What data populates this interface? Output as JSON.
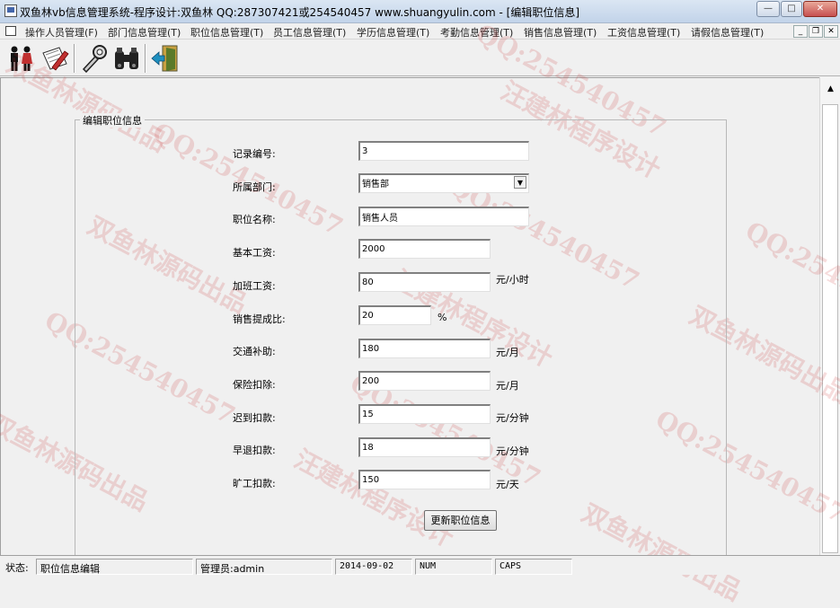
{
  "window": {
    "title": "双鱼林vb信息管理系统-程序设计:双鱼林 QQ:287307421或254540457 www.shuangyulin.com - [编辑职位信息]",
    "controls": {
      "minimize": "—",
      "maximize": "□",
      "close": "✕"
    }
  },
  "menu": {
    "items": [
      "操作人员管理(F)",
      "部门信息管理(T)",
      "职位信息管理(T)",
      "员工信息管理(T)",
      "学历信息管理(T)",
      "考勤信息管理(T)",
      "销售信息管理(T)",
      "工资信息管理(T)",
      "请假信息管理(T)"
    ],
    "mdi_controls": {
      "minimize": "_",
      "restore": "❐",
      "close": "✕"
    }
  },
  "toolbar": {
    "icons": [
      "people-icon",
      "edit-icon",
      "wrench-icon",
      "binoculars-icon",
      "exit-door-icon"
    ]
  },
  "form": {
    "group_title": "编辑职位信息",
    "fields": {
      "record_no": {
        "label": "记录编号:",
        "value": "3"
      },
      "department": {
        "label": "所属部门:",
        "value": "销售部"
      },
      "position_name": {
        "label": "职位名称:",
        "value": "销售人员"
      },
      "base_salary": {
        "label": "基本工资:",
        "value": "2000"
      },
      "overtime_pay": {
        "label": "加班工资:",
        "value": "80",
        "unit": "元/小时"
      },
      "commission_rate": {
        "label": "销售提成比:",
        "value": "20",
        "unit": "%"
      },
      "transport_allowance": {
        "label": "交通补助:",
        "value": "180",
        "unit": "元/月"
      },
      "insurance_deduction": {
        "label": "保险扣除:",
        "value": "200",
        "unit": "元/月"
      },
      "late_deduction": {
        "label": "迟到扣款:",
        "value": "15",
        "unit": "元/分钟"
      },
      "early_leave_deduction": {
        "label": "早退扣款:",
        "value": "18",
        "unit": "元/分钟"
      },
      "absence_deduction": {
        "label": "旷工扣款:",
        "value": "150",
        "unit": "元/天"
      }
    },
    "submit_label": "更新职位信息"
  },
  "statusbar": {
    "status_label": "状态:",
    "status_value": "职位信息编辑",
    "admin": "管理员:admin",
    "date": "2014-09-02",
    "num": "NUM",
    "caps": "CAPS"
  },
  "watermarks": {
    "author": "汪建林程序设计",
    "qq": "QQ:254540457",
    "source": "双鱼林源码出品"
  },
  "colors": {
    "title_bar": "#c2d3e9",
    "background": "#f0f0f0",
    "watermark": "#c82828"
  }
}
